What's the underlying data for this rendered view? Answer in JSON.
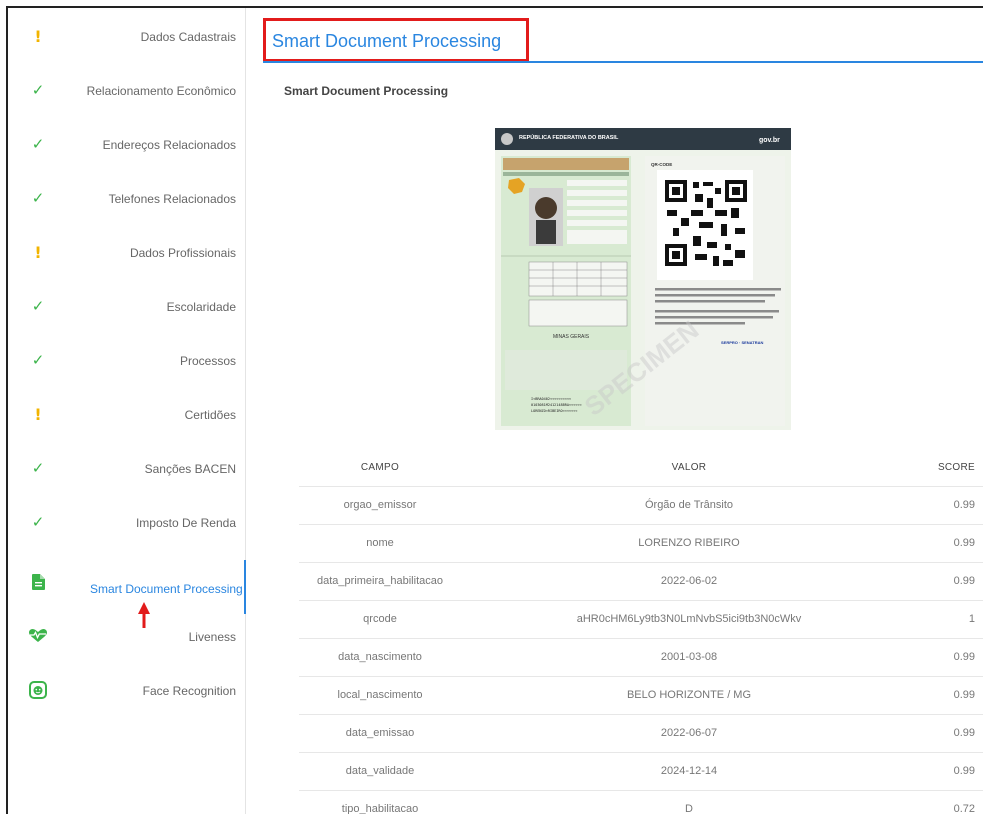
{
  "sidebar": {
    "items": [
      {
        "label": "Dados Cadastrais",
        "status": "warning"
      },
      {
        "label": "Relacionamento Econômico",
        "status": "ok"
      },
      {
        "label": "Endereços Relacionados",
        "status": "ok"
      },
      {
        "label": "Telefones Relacionados",
        "status": "ok"
      },
      {
        "label": "Dados Profissionais",
        "status": "warning"
      },
      {
        "label": "Escolaridade",
        "status": "ok"
      },
      {
        "label": "Processos",
        "status": "ok"
      },
      {
        "label": "Certidões",
        "status": "warning"
      },
      {
        "label": "Sanções BACEN",
        "status": "ok"
      },
      {
        "label": "Imposto De Renda",
        "status": "ok"
      },
      {
        "label": "Smart Document Processing",
        "status": "active",
        "icon": "document-icon"
      },
      {
        "label": "Liveness",
        "icon": "heartbeat-icon"
      },
      {
        "label": "Face Recognition",
        "icon": "face-scan-icon"
      }
    ]
  },
  "header": {
    "tab_title": "Smart Document Processing"
  },
  "section": {
    "title": "Smart Document Processing"
  },
  "document": {
    "header_text": "REPÚBLICA FEDERATIVA DO BRASIL",
    "brand": "gov.br",
    "qr_label": "QR-CODE",
    "state": "MINAS GERAIS",
    "watermark": "SPECIMEN",
    "issuer_footer": "SERPRO · SENATRAN"
  },
  "table": {
    "headers": [
      "CAMPO",
      "VALOR",
      "SCORE"
    ],
    "rows": [
      [
        "orgao_emissor",
        "Órgão de Trânsito",
        "0.99"
      ],
      [
        "nome",
        "LORENZO RIBEIRO",
        "0.99"
      ],
      [
        "data_primeira_habilitacao",
        "2022-06-02",
        "0.99"
      ],
      [
        "qrcode",
        "aHR0cHM6Ly9tb3N0LmNvbS5ici9tb3N0cWkv",
        "1"
      ],
      [
        "data_nascimento",
        "2001-03-08",
        "0.99"
      ],
      [
        "local_nascimento",
        "BELO HORIZONTE / MG",
        "0.99"
      ],
      [
        "data_emissao",
        "2022-06-07",
        "0.99"
      ],
      [
        "data_validade",
        "2024-12-14",
        "0.99"
      ],
      [
        "tipo_habilitacao",
        "D",
        "0.72"
      ]
    ]
  },
  "colors": {
    "accent": "#2a86e0",
    "warning": "#f2b400",
    "ok": "#3cb44b",
    "highlight": "#e21b1b"
  }
}
